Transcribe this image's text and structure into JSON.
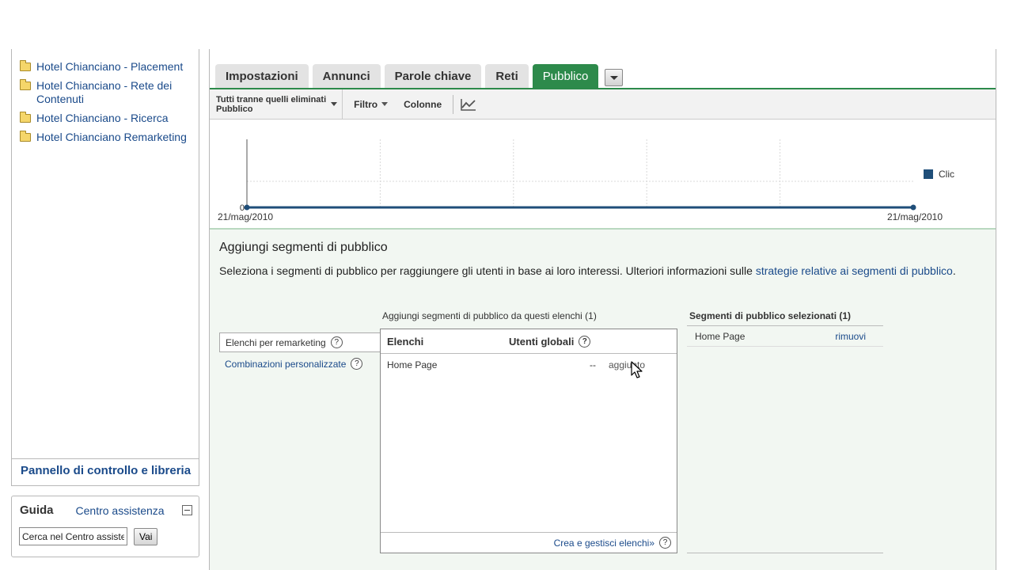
{
  "sidebar": {
    "folders": [
      {
        "label": "Hotel Chianciano - Placement"
      },
      {
        "label": "Hotel Chianciano - Rete dei Contenuti"
      },
      {
        "label": "Hotel Chianciano - Ricerca"
      },
      {
        "label": "Hotel Chianciano Remarketing"
      }
    ],
    "footer_link": "Pannello di controllo e libreria"
  },
  "help": {
    "title": "Guida",
    "center_link": "Centro assistenza",
    "search_value": "Cerca nel Centro assistenza",
    "button": "Vai"
  },
  "tabs": [
    {
      "label": "Impostazioni",
      "active": false
    },
    {
      "label": "Annunci",
      "active": false
    },
    {
      "label": "Parole chiave",
      "active": false
    },
    {
      "label": "Reti",
      "active": false
    },
    {
      "label": "Pubblico",
      "active": true
    }
  ],
  "toolbar": {
    "filter_line1": "Tutti tranne quelli eliminati",
    "filter_line2": "Pubblico",
    "filter_button": "Filtro",
    "columns_button": "Colonne"
  },
  "chart_data": {
    "type": "line",
    "x": [
      "21/mag/2010",
      "21/mag/2010"
    ],
    "series": [
      {
        "name": "Clic",
        "values": [
          0,
          0
        ],
        "color": "#1f4e79"
      }
    ],
    "x_tick_labels": [
      "21/mag/2010",
      "21/mag/2010"
    ],
    "y_tick_labels": [
      "0"
    ],
    "grid": true,
    "legend": "right"
  },
  "segments": {
    "title": "Aggiungi segmenti di pubblico",
    "desc_text": "Seleziona i segmenti di pubblico per raggiungere gli utenti in base ai loro interessi. Ulteriori informazioni sulle ",
    "desc_link": "strategie relative ai segmenti di pubblico",
    "desc_end": ".",
    "list_types": {
      "active": "Elenchi per remarketing",
      "other": "Combinazioni personalizzate"
    },
    "lists_heading": "Aggiungi segmenti di pubblico da questi elenchi (1)",
    "lists_columns": {
      "name": "Elenchi",
      "users": "Utenti globali"
    },
    "lists_rows": [
      {
        "name": "Home Page",
        "users": "--",
        "status": "aggiunto"
      }
    ],
    "lists_footer_link": "Crea e gestisci elenchi»",
    "selected_heading": "Segmenti di pubblico selezionati (1)",
    "selected_rows": [
      {
        "name": "Home Page",
        "action": "rimuovi"
      }
    ]
  },
  "colors": {
    "accent": "#2d8a4b",
    "link": "#1a4a8a",
    "series": "#1f4e79"
  }
}
